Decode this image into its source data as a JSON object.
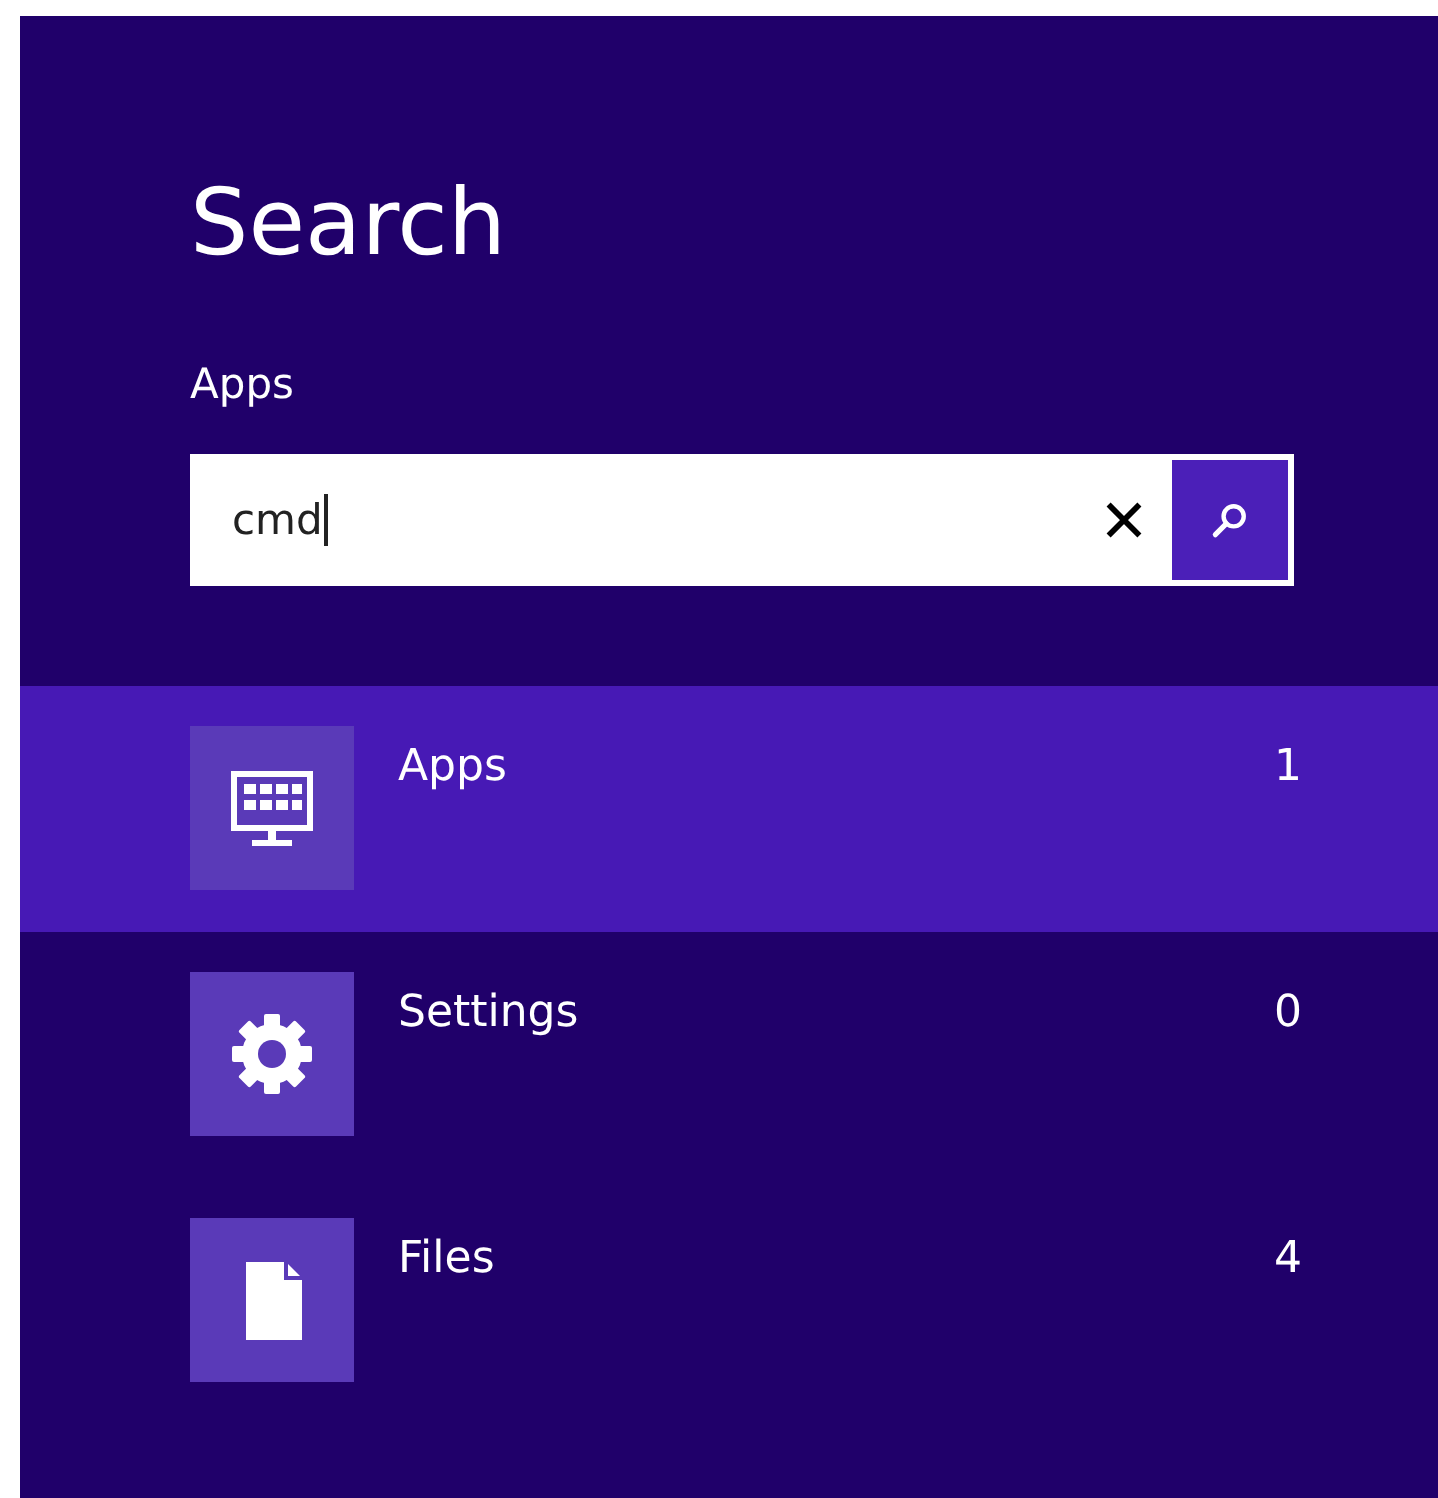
{
  "title": "Search",
  "scope": "Apps",
  "search": {
    "value": "cmd"
  },
  "results": [
    {
      "kind": "apps",
      "label": "Apps",
      "count": "1",
      "selected": true
    },
    {
      "kind": "settings",
      "label": "Settings",
      "count": "0",
      "selected": false
    },
    {
      "kind": "files",
      "label": "Files",
      "count": "4",
      "selected": false
    }
  ]
}
